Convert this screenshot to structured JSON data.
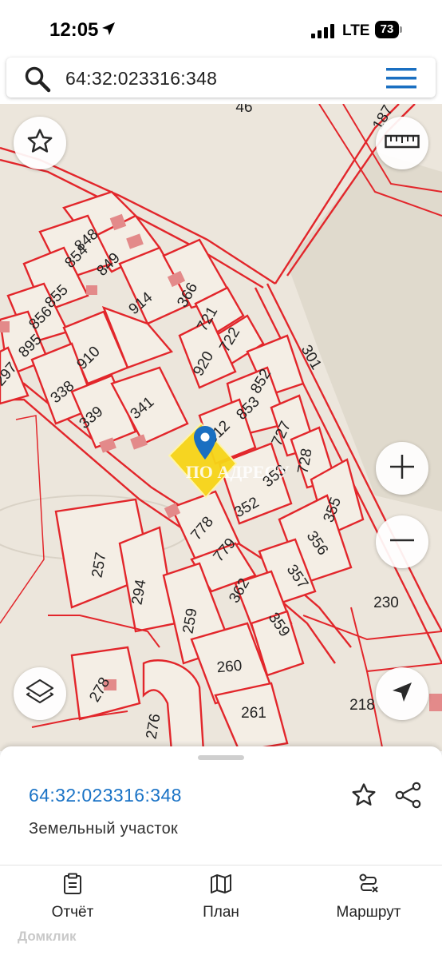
{
  "status_bar": {
    "time": "12:05",
    "network": "LTE",
    "battery": "73"
  },
  "search": {
    "query": "64:32:023316:348"
  },
  "map": {
    "plot_labels": [
      "848",
      "854",
      "849",
      "855",
      "856",
      "895",
      "297",
      "914",
      "366",
      "721",
      "722",
      "910",
      "920",
      "852",
      "338",
      "339",
      "341",
      "853",
      "727",
      "912",
      "728",
      "353",
      "352",
      "355",
      "778",
      "779",
      "356",
      "257",
      "294",
      "357",
      "362",
      "359",
      "230",
      "259",
      "260",
      "218",
      "278",
      "276",
      "261",
      "301",
      "46",
      "187"
    ],
    "watermark": "ПО АДРЕСУ"
  },
  "sheet": {
    "cadastral_number": "64:32:023316:348",
    "property_type": "Земельный участок"
  },
  "tabs": [
    {
      "label": "Отчёт",
      "icon": "report-icon"
    },
    {
      "label": "План",
      "icon": "map-plan-icon"
    },
    {
      "label": "Маршрут",
      "icon": "route-icon"
    }
  ],
  "footer": {
    "brand": "Домклик"
  },
  "colors": {
    "boundary": "#e2262b",
    "accent": "#1a73c6",
    "parcel_highlight": "#f7d518"
  }
}
